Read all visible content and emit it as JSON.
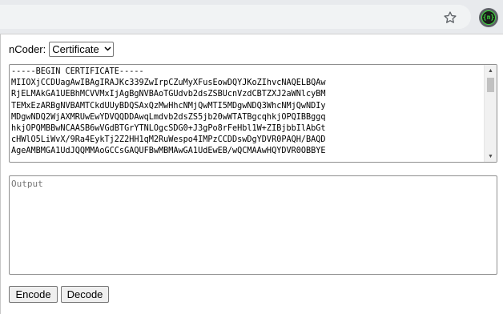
{
  "browser": {
    "bookmark_icon": "star-icon",
    "extension_icon": "ncoder-extension-icon",
    "extension_label": "{n}"
  },
  "app": {
    "label": "nCoder:",
    "mode": {
      "selected": "Certificate"
    },
    "input": {
      "lines": [
        "-----BEGIN CERTIFICATE-----",
        "MIIOXjCCDUagAwIBAgIRAJKc339ZwIrpCZuMyXFusEowDQYJKoZIhvcNAQELBQAw",
        "RjELMAkGA1UEBhMCVVMxIjAgBgNVBAoTGUdvb2dsZSBUcnVzdCBTZXJ2aWNlcyBM",
        "TEMxEzARBgNVBAMTCkdUUyBDQSAxQzMwHhcNMjQwMTI5MDgwNDQ3WhcNMjQwNDIy",
        "MDgwNDQ2WjAXMRUwEwYDVQQDDAwqLmdvb2dsZS5jb20wWTATBgcqhkjOPQIBBggq",
        "hkjOPQMBBwNCAASB6wVGdBTGrYTNLOgcSDG0+J3gPo8rFeHbl1W+ZIBjbbIlAbGt",
        "cHWlO5LiWvX/9Ra4EykTj2Z2HH1qM2RuWespo4IMPzCCDDswDgYDVR0PAQH/BAQD",
        "AgeAMBMGA1UdJQQMMAoGCCsGAQUFBwMBMAwGA1UdEwEB/wQCMAAwHQYDVR0OBBYE"
      ]
    },
    "output": {
      "placeholder": "Output"
    },
    "buttons": {
      "encode": "Encode",
      "decode": "Decode"
    }
  }
}
